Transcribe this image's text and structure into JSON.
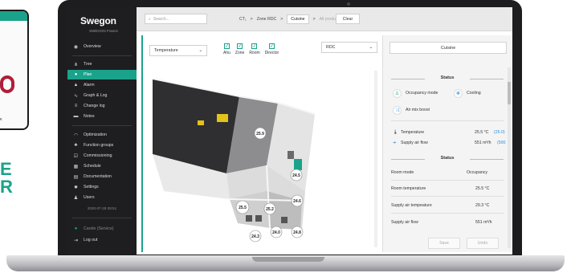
{
  "phone": {
    "label": "ow"
  },
  "side_text": [
    "E",
    "R"
  ],
  "sidebar": {
    "brand": "Swegon",
    "subtitle": "SWEGON France",
    "items": [
      {
        "label": "Overview",
        "icon": "eye-icon"
      },
      {
        "label": "Tree",
        "icon": "tree-icon"
      },
      {
        "label": "Plan",
        "icon": "map-pin-icon",
        "active": true
      },
      {
        "label": "Alarm",
        "icon": "bell-icon"
      },
      {
        "label": "Graph & Log",
        "icon": "graph-icon"
      },
      {
        "label": "Change log",
        "icon": "list-icon"
      },
      {
        "label": "Notes",
        "icon": "note-icon"
      },
      {
        "label": "Optimization",
        "icon": "gauge-icon"
      },
      {
        "label": "Function groups",
        "icon": "group-icon"
      },
      {
        "label": "Commissioning",
        "icon": "checklist-icon"
      },
      {
        "label": "Schedule",
        "icon": "calendar-icon"
      },
      {
        "label": "Documentation",
        "icon": "document-icon"
      },
      {
        "label": "Settings",
        "icon": "gear-icon"
      },
      {
        "label": "Users",
        "icon": "users-icon"
      }
    ],
    "timestamp": "2020-07-28 08:51",
    "user": "Carole (Service)",
    "logout": "Log out"
  },
  "topbar": {
    "search_placeholder": "Search...",
    "crumbs": [
      "CT₁",
      ">",
      "Zone RDC",
      ">",
      "Cuisine",
      ">",
      "All product"
    ],
    "clear_label": "Clear"
  },
  "main": {
    "view_select": "Temperature",
    "checks": [
      {
        "label": "Ahu",
        "checked": true
      },
      {
        "label": "Zone",
        "checked": true
      },
      {
        "label": "Room",
        "checked": true
      },
      {
        "label": "Director",
        "checked": true
      }
    ],
    "floor_select": "RDC",
    "room_values": [
      "25.9",
      "24.5",
      "24.6",
      "25.5",
      "25.2",
      "24.3",
      "24.0",
      "24.8"
    ]
  },
  "panel": {
    "zone_name": "Cuisine",
    "status_title": "Status",
    "status_items": [
      {
        "label": "Occupancy mode",
        "icon": "person-icon"
      },
      {
        "label": "Cooling",
        "icon": "snowflake-icon"
      },
      {
        "label": "Air mix boost",
        "icon": "shuffle-icon"
      }
    ],
    "readings": [
      {
        "label": "Temperature",
        "value": "25.5 °C",
        "setpoint": "(25.0)",
        "icon": "thermometer-icon"
      },
      {
        "label": "Supply air flow",
        "value": "551 m³/h",
        "setpoint": "(500",
        "icon": "arrow-right-icon"
      }
    ],
    "status_title2": "Status",
    "rows": [
      {
        "label": "Room mode",
        "value": "Occupancy"
      },
      {
        "label": "Room temperature",
        "value": "25.5 °C"
      },
      {
        "label": "Supply air tempeature",
        "value": "29.3 °C"
      },
      {
        "label": "Supply air flow",
        "value": "551 m³/h"
      }
    ],
    "save_label": "Save",
    "undo_label": "Undo"
  },
  "colors": {
    "accent": "#1aa38a",
    "sidebar_bg": "#1e1e20",
    "link_blue": "#2f8fd6"
  }
}
